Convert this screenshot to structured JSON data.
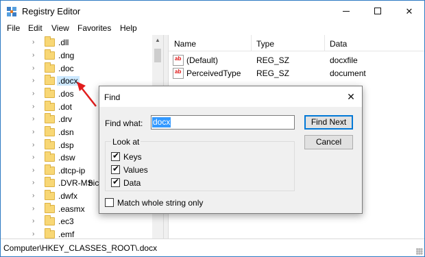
{
  "window": {
    "title": "Registry Editor",
    "accent_color": "#2b79c2",
    "controls": {
      "minimize": "—",
      "maximize": "☐",
      "close": "✕"
    }
  },
  "menu": [
    "File",
    "Edit",
    "View",
    "Favorites",
    "Help"
  ],
  "tree": {
    "items": [
      ".dll",
      ".dng",
      ".doc",
      ".docx",
      ".dos",
      ".dot",
      ".drv",
      ".dsn",
      ".dsp",
      ".dsw",
      ".dtcp-ip",
      ".DVR-MS",
      ".dwfx",
      ".easmx",
      ".ec3",
      ".emf"
    ],
    "selected": ".docx",
    "overflow_text": "bic"
  },
  "list": {
    "columns": [
      "Name",
      "Type",
      "Data"
    ],
    "rows": [
      {
        "name": "(Default)",
        "type": "REG_SZ",
        "data": "docxfile"
      },
      {
        "name": "PerceivedType",
        "type": "REG_SZ",
        "data": "document"
      }
    ]
  },
  "status": {
    "path": "Computer\\HKEY_CLASSES_ROOT\\.docx"
  },
  "dialog": {
    "title": "Find",
    "find_what_label": "Find what:",
    "find_value": "docx",
    "find_next_label": "Find Next",
    "cancel_label": "Cancel",
    "look_at_label": "Look at",
    "options": [
      {
        "label": "Keys",
        "checked": true
      },
      {
        "label": "Values",
        "checked": true
      },
      {
        "label": "Data",
        "checked": true
      }
    ],
    "match_whole": {
      "label": "Match whole string only",
      "checked": false
    }
  },
  "annotation_color": "#e11d1d",
  "icons": {
    "app": "registry-icon",
    "value": "string-value-icon",
    "folder": "folder-icon",
    "expand": "chevron-right-icon"
  }
}
